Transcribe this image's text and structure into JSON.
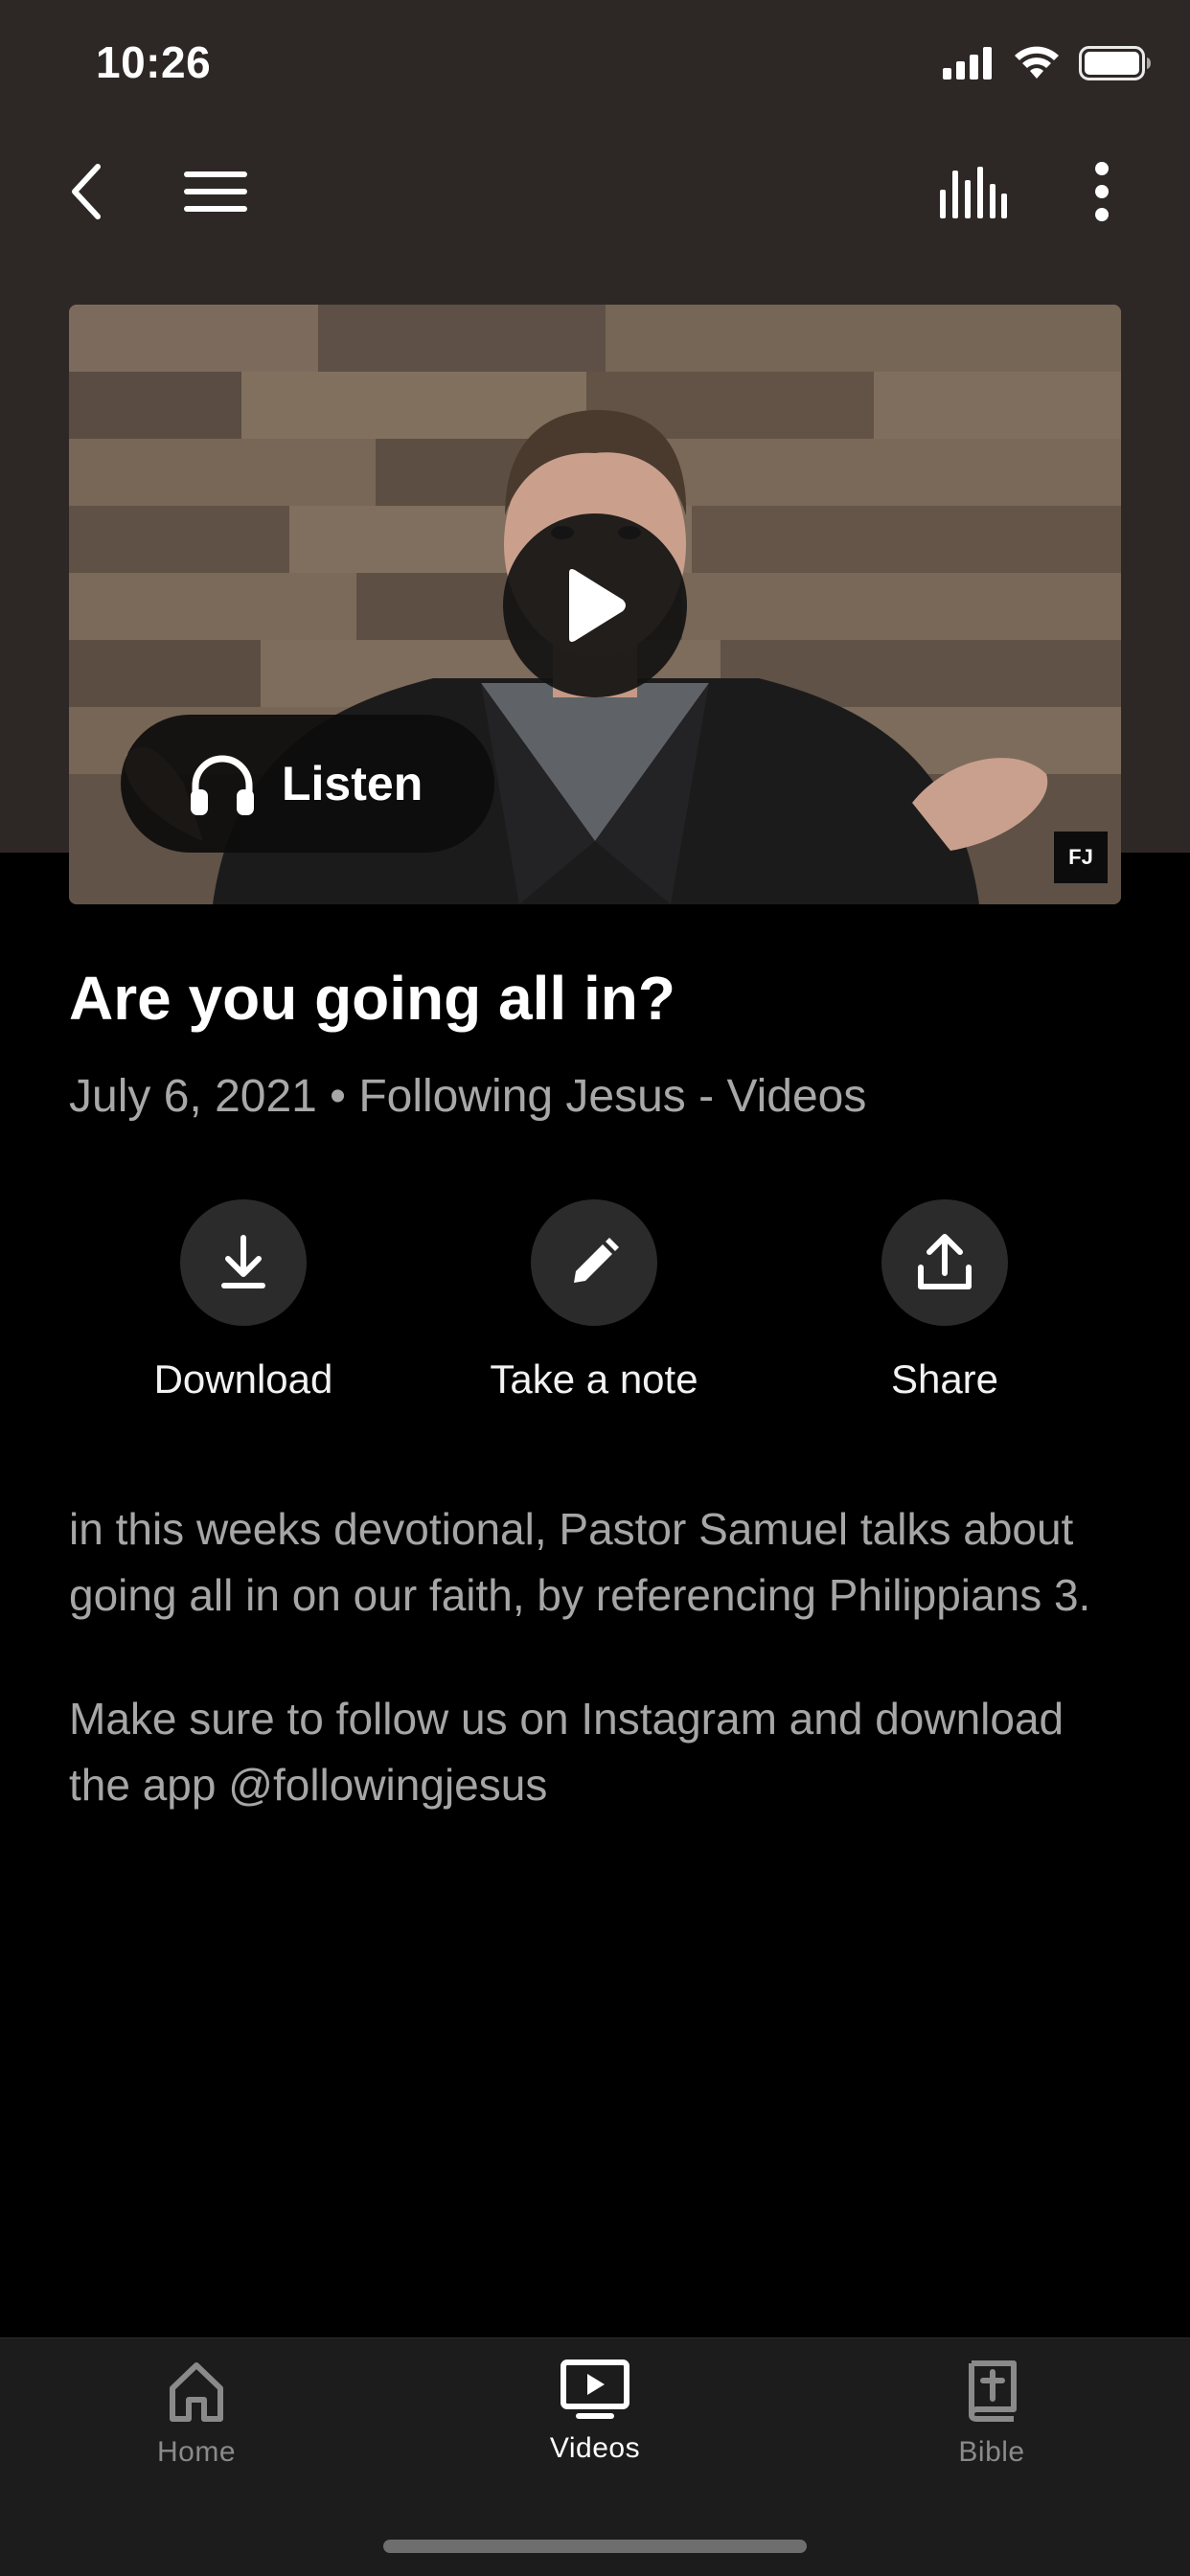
{
  "status_bar": {
    "time": "10:26"
  },
  "icons": {
    "back": "back-chevron-icon",
    "menu": "hamburger-menu-icon",
    "audio": "audio-bars-icon",
    "more": "more-vertical-icon",
    "play": "play-icon",
    "headphones": "headphones-icon",
    "download": "download-icon",
    "note": "pencil-icon",
    "share": "share-icon",
    "home": "home-icon",
    "videos": "videos-icon",
    "bible": "bible-icon"
  },
  "video": {
    "listen_label": "Listen",
    "badge": "FJ"
  },
  "content": {
    "title": "Are you going all in?",
    "meta": "July 6, 2021 • Following Jesus - Videos",
    "description": [
      "in this weeks devotional, Pastor Samuel talks about going all in on our faith, by referencing Philippians 3.",
      "Make sure to follow us on Instagram and download the app @followingjesus"
    ]
  },
  "actions": [
    {
      "label": "Download"
    },
    {
      "label": "Take a note"
    },
    {
      "label": "Share"
    }
  ],
  "tabs": [
    {
      "label": "Home",
      "active": false
    },
    {
      "label": "Videos",
      "active": true
    },
    {
      "label": "Bible",
      "active": false
    }
  ],
  "colors": {
    "header_bg": "#2d2826",
    "page_bg": "#000000",
    "tabbar_bg": "#1c1c1c",
    "secondary_text": "#a8a8a8"
  }
}
